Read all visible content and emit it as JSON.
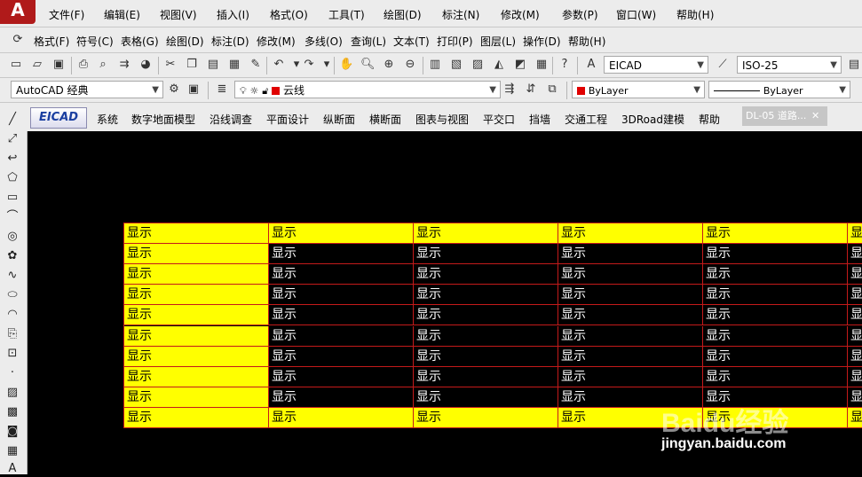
{
  "app": {
    "logo": "A"
  },
  "menubar": [
    "文件(F)",
    "编辑(E)",
    "视图(V)",
    "插入(I)",
    "格式(O)",
    "工具(T)",
    "绘图(D)",
    "标注(N)",
    "修改(M)",
    "参数(P)",
    "窗口(W)",
    "帮助(H)"
  ],
  "toolbar2": [
    "格式(F)",
    "符号(C)",
    "表格(G)",
    "绘图(D)",
    "标注(D)",
    "修改(M)",
    "多线(O)",
    "查询(L)",
    "文本(T)",
    "打印(P)",
    "图层(L)",
    "操作(D)",
    "帮助(H)"
  ],
  "toolbar3": {
    "text_style": "EICAD",
    "dim_style": "ISO-25"
  },
  "toolbar4": {
    "workspace": "AutoCAD 经典",
    "layer": "云线",
    "color": "ByLayer",
    "linetype": "ByLayer"
  },
  "eicad_menu": {
    "logo": "EICAD",
    "items": [
      "系统",
      "数字地面模型",
      "沿线调查",
      "平面设计",
      "纵断面",
      "横断面",
      "图表与视图",
      "平交口",
      "挡墙",
      "交通工程",
      "3DRoad建模",
      "帮助"
    ],
    "doc_tab": "DL-05 道路..."
  },
  "table": {
    "cell_text": "显示",
    "rows": 10,
    "highlight_rows": [
      0,
      9
    ],
    "highlight_col": 0
  },
  "watermark": {
    "logo": "Baidu经验",
    "url": "jingyan.baidu.com"
  },
  "colors": {
    "highlight": "#ffff00",
    "grid": "#c41a1a",
    "background": "#000000"
  }
}
